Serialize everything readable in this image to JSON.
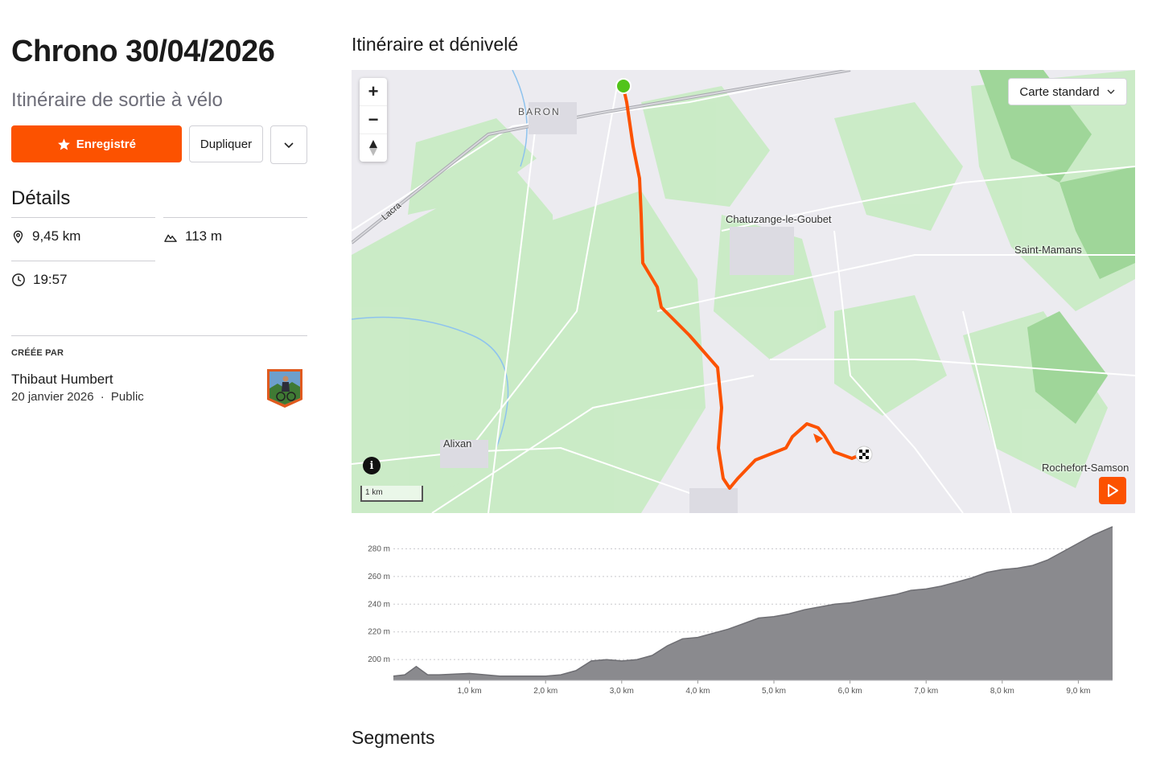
{
  "route": {
    "title": "Chrono 30/04/2026",
    "subtitle": "Itinéraire de sortie à vélo",
    "actions": {
      "saved_label": "Enregistré",
      "duplicate_label": "Dupliquer"
    }
  },
  "details": {
    "heading": "Détails",
    "distance": "9,45 km",
    "elevation_gain": "113 m",
    "duration": "19:57"
  },
  "creator": {
    "label": "CRÉÉE PAR",
    "name": "Thibaut Humbert",
    "date": "20 janvier 2026",
    "separator": "·",
    "visibility": "Public"
  },
  "map_section": {
    "heading": "Itinéraire et dénivelé",
    "map_type": "Carte standard",
    "scale_label": "1 km",
    "places": {
      "baron": "BARON",
      "chatuzange": "Chatuzange-le-Goubet",
      "saint_mamans": "Saint-Mamans",
      "alixan": "Alixan",
      "rochefort": "Rochefort-Samson",
      "lacra": "Lacra"
    },
    "colors": {
      "route": "#fc5200",
      "start": "#52c41a",
      "map_green": "#c9ebc4"
    }
  },
  "segments_heading": "Segments",
  "chart_data": {
    "type": "area",
    "title": "",
    "xlabel": "",
    "ylabel": "",
    "x_unit": "km",
    "y_unit": "m",
    "xlim": [
      0,
      9.45
    ],
    "ylim": [
      185,
      300
    ],
    "x_ticks": [
      "1,0 km",
      "2,0 km",
      "3,0 km",
      "4,0 km",
      "5,0 km",
      "6,0 km",
      "7,0 km",
      "8,0 km",
      "9,0 km"
    ],
    "y_ticks": [
      "200 m",
      "220 m",
      "240 m",
      "260 m",
      "280 m"
    ],
    "grid": true,
    "x": [
      0,
      0.15,
      0.3,
      0.45,
      0.6,
      1.0,
      1.4,
      1.8,
      2.0,
      2.2,
      2.4,
      2.6,
      2.8,
      3.0,
      3.2,
      3.4,
      3.6,
      3.8,
      4.0,
      4.2,
      4.4,
      4.6,
      4.8,
      5.0,
      5.2,
      5.4,
      5.6,
      5.8,
      6.0,
      6.2,
      6.4,
      6.6,
      6.8,
      7.0,
      7.2,
      7.4,
      7.6,
      7.8,
      8.0,
      8.2,
      8.4,
      8.6,
      8.8,
      9.0,
      9.2,
      9.45
    ],
    "y": [
      188,
      189,
      195,
      189,
      189,
      190,
      188,
      188,
      188,
      189,
      192,
      199,
      200,
      199,
      200,
      203,
      210,
      215,
      216,
      219,
      222,
      226,
      230,
      231,
      233,
      236,
      238,
      240,
      241,
      243,
      245,
      247,
      250,
      251,
      253,
      256,
      259,
      263,
      265,
      266,
      268,
      272,
      278,
      284,
      290,
      296
    ]
  }
}
